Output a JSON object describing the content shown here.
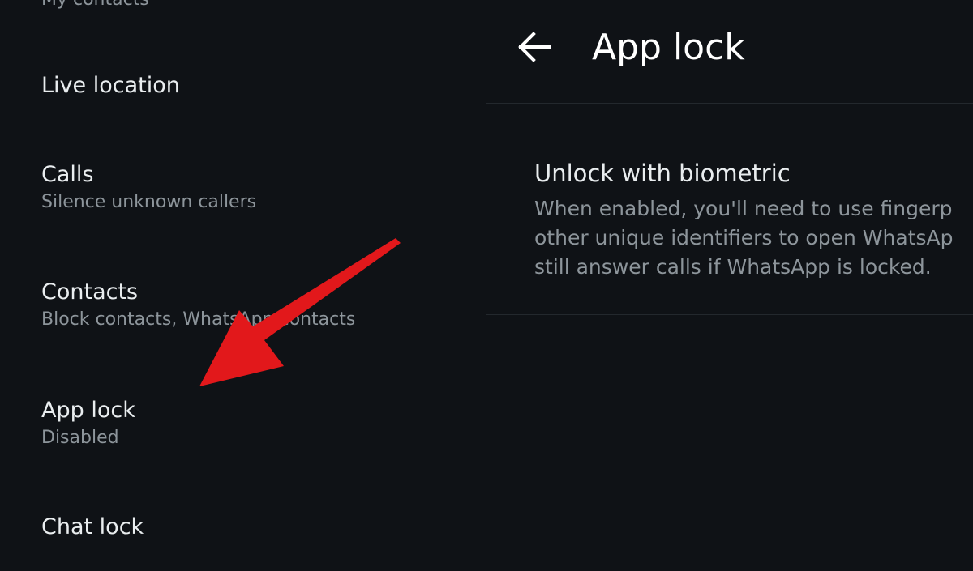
{
  "settings_list": {
    "cut_top_subtitle": "My contacts",
    "items": [
      {
        "title": "Live location",
        "subtitle": ""
      },
      {
        "title": "Calls",
        "subtitle": "Silence unknown callers"
      },
      {
        "title": "Contacts",
        "subtitle": "Block contacts, WhatsApp contacts"
      },
      {
        "title": "App lock",
        "subtitle": "Disabled"
      },
      {
        "title": "Chat lock",
        "subtitle": ""
      }
    ]
  },
  "app_lock_screen": {
    "title": "App lock",
    "back_icon": "arrow-left-icon",
    "option": {
      "title": "Unlock with biometric",
      "description_lines": [
        "When enabled, you'll need to use fingerp",
        "other unique identifiers to open WhatsAp",
        "still answer calls if WhatsApp is locked."
      ]
    }
  },
  "colors": {
    "background": "#0f1216",
    "primary_text": "#e9edef",
    "secondary_text": "#8d959b",
    "annotation_arrow": "#e2181b"
  }
}
